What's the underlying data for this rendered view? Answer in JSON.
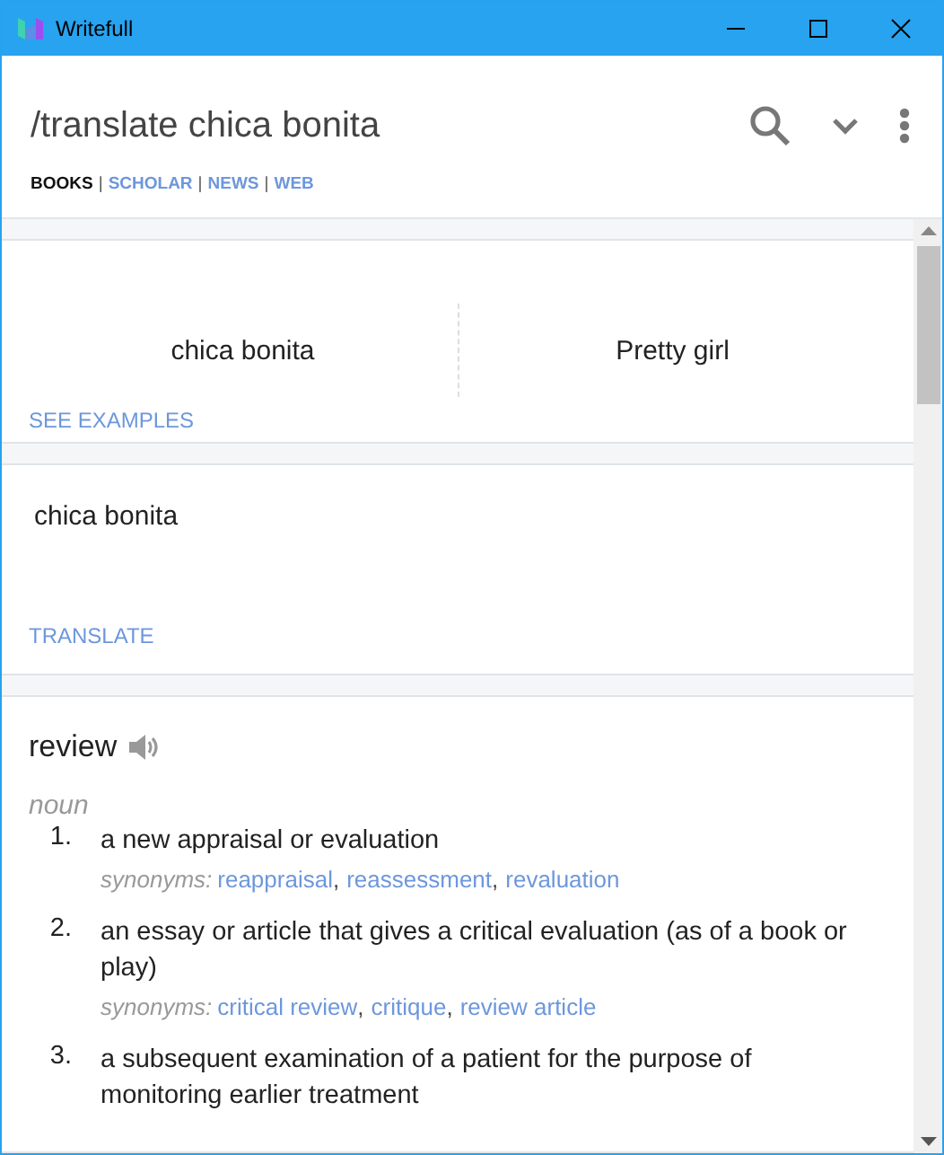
{
  "window": {
    "title": "Writefull"
  },
  "query": "/translate chica bonita",
  "sources": [
    {
      "label": "BOOKS",
      "selected": true
    },
    {
      "separator": "|",
      "label": "SCHOLAR",
      "selected": false
    },
    {
      "separator": "|",
      "label": "NEWS",
      "selected": false
    },
    {
      "separator": "|",
      "label": "WEB",
      "selected": false
    }
  ],
  "translation": {
    "source": "chica bonita",
    "target": "Pretty girl",
    "action": "SEE EXAMPLES"
  },
  "translate_card": {
    "text": "chica bonita",
    "action": "TRANSLATE"
  },
  "definition": {
    "word": "review",
    "part_of_speech": "noun",
    "senses": [
      {
        "number": "1.",
        "text": "a new appraisal or evaluation",
        "synonyms_label": "synonyms:",
        "synonyms": [
          {
            "word": "reappraisal",
            "comma": ","
          },
          {
            "word": "reassessment",
            "comma": ","
          },
          {
            "word": "revaluation"
          }
        ]
      },
      {
        "number": "2.",
        "text": "an essay or article that gives a critical evaluation (as of a book or play)",
        "synonyms_label": "synonyms:",
        "synonyms": [
          {
            "word": "critical review",
            "comma": ","
          },
          {
            "word": "critique",
            "comma": ","
          },
          {
            "word": "review article"
          }
        ]
      },
      {
        "number": "3.",
        "text": "a subsequent examination of a patient for the purpose of monitoring earlier treatment"
      }
    ]
  }
}
